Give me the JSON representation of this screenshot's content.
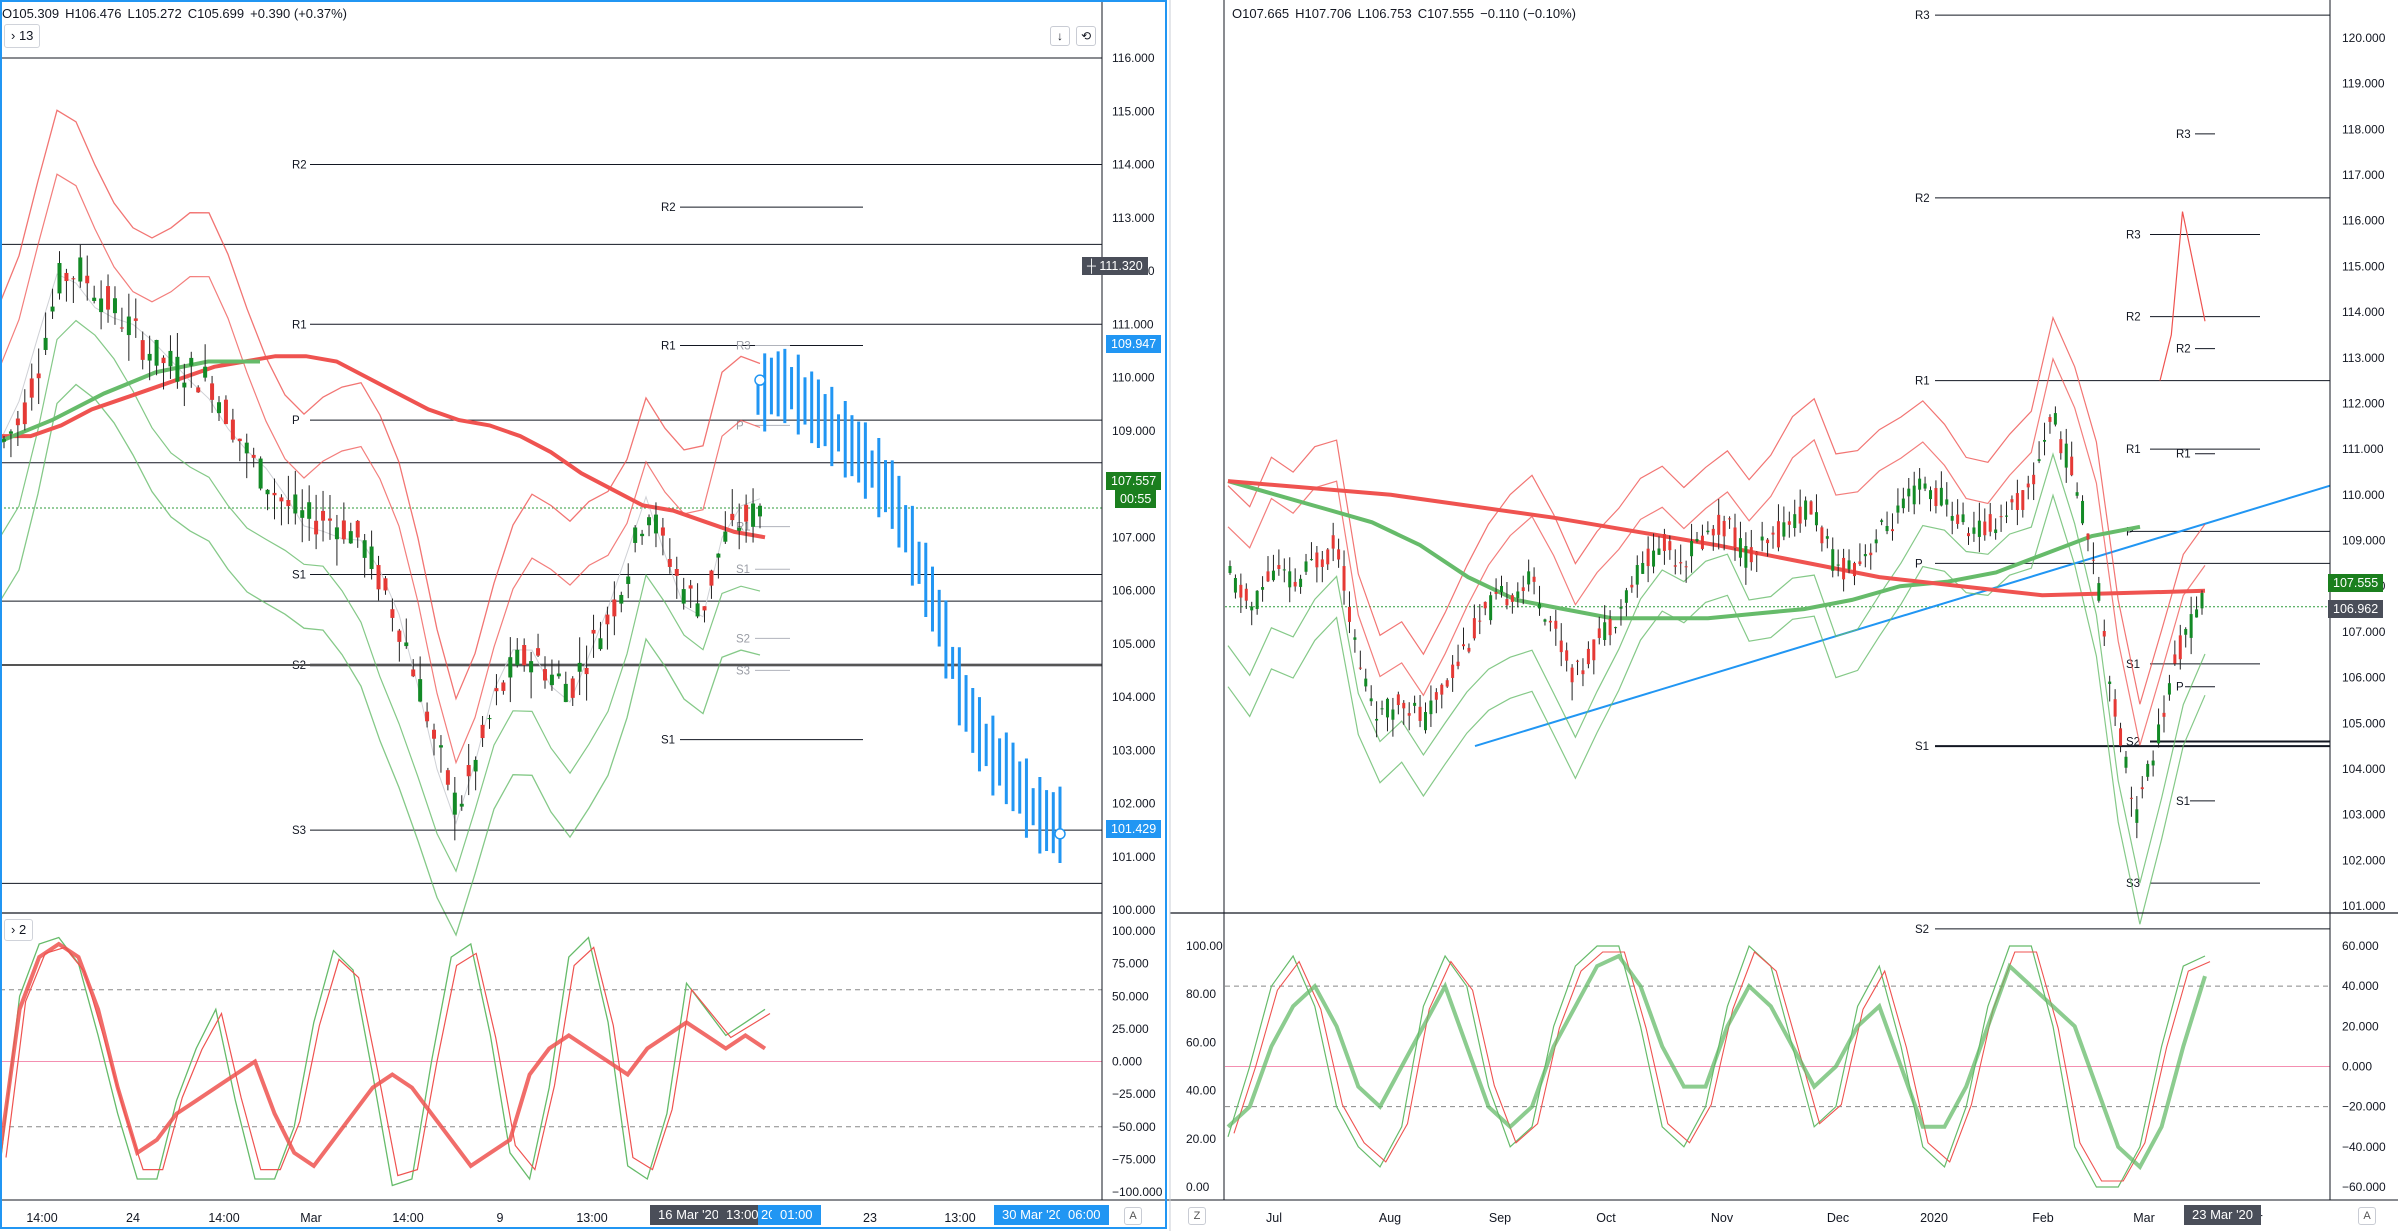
{
  "colors": {
    "accent": "#2196f3",
    "up": "#26a69a",
    "candle_up": "#138a26",
    "candle_down": "#e53935",
    "ma_red": "#ef5350",
    "ma_green": "#66bb6a",
    "grid": "#131722",
    "stoch_pink": "#f48fb1"
  },
  "left": {
    "ohlc": {
      "open": "O105.309",
      "high": "H106.476",
      "low": "L105.272",
      "close": "C105.699",
      "change": "+0.390 (+0.37%)"
    },
    "collapse_main": "13",
    "collapse_sub": "2",
    "price_axis": [
      "116.000",
      "115.000",
      "114.000",
      "113.000",
      "112.000",
      "111.000",
      "110.000",
      "109.000",
      "108.000",
      "107.000",
      "106.000",
      "105.000",
      "104.000",
      "103.000",
      "102.000",
      "101.000",
      "100.000"
    ],
    "price_tags": {
      "crosshair": "111.320",
      "blue_high": "109.947",
      "last": "107.557",
      "countdown": "00:55",
      "blue_low": "101.429"
    },
    "osc_axis": [
      "100.000",
      "75.000",
      "50.000",
      "25.000",
      "0.000",
      "−25.000",
      "−50.000",
      "−75.000",
      "−100.000"
    ],
    "time_axis": [
      "14:00",
      "24",
      "14:00",
      "Mar",
      "14:00",
      "9",
      "13:00",
      "23",
      "13:00"
    ],
    "time_badges": {
      "date1": "16 Mar '20",
      "time1": "13:00",
      "time2": "20",
      "time3": "01:00",
      "date2": "30 Mar '20",
      "time4": "06:00"
    },
    "scale_mode": "A",
    "pivot_labels": {
      "R2a": "R2",
      "R1a": "R1",
      "Pa": "P",
      "S1a": "S1",
      "S2a": "S2",
      "S3a": "S3",
      "R2b": "R2",
      "R1b": "R1",
      "S1b": "S1",
      "R3c": "R3",
      "P2c": "P",
      "R1c": "R1",
      "S1c": "S1",
      "S2c": "S2",
      "S3c": "S3"
    }
  },
  "right": {
    "ohlc": {
      "open": "O107.665",
      "high": "H107.706",
      "low": "L106.753",
      "close": "C107.555",
      "change": "−0.110 (−0.10%)"
    },
    "price_axis": [
      "120.000",
      "119.000",
      "118.000",
      "117.000",
      "116.000",
      "115.000",
      "114.000",
      "113.000",
      "112.000",
      "111.000",
      "110.000",
      "109.000",
      "108.000",
      "107.000",
      "106.000",
      "105.000",
      "104.000",
      "103.000",
      "102.000",
      "101.000"
    ],
    "price_tags": {
      "last": "107.555",
      "secondary": "106.962"
    },
    "osc_left_axis": [
      "100.00",
      "80.00",
      "60.00",
      "40.00",
      "20.00",
      "0.00"
    ],
    "osc_right_axis": [
      "60.000",
      "40.000",
      "20.000",
      "0.000",
      "−20.000",
      "−40.000",
      "−60.000"
    ],
    "time_axis": [
      "Jul",
      "Aug",
      "Sep",
      "Oct",
      "Nov",
      "Dec",
      "2020",
      "Feb",
      "Mar",
      "pr"
    ],
    "time_badge": "23 Mar '20",
    "scale_mode_left": "Z",
    "scale_mode_right": "A",
    "pivot_labels": {
      "R3a": "R3",
      "R2a": "R2",
      "R1a": "R1",
      "Pa": "P",
      "S1a": "S1",
      "S2a": "S2",
      "R3b": "R3",
      "R3c": "R3",
      "R2c": "R2",
      "R2d": "R2",
      "R1c": "R1",
      "R1d": "R1",
      "Pc": "P",
      "S1c": "S1",
      "S2c": "S2",
      "Pd": "P",
      "S1d": "S1",
      "S3d": "S3"
    }
  },
  "chart_data": [
    {
      "type": "line",
      "title": "",
      "ylim": [
        100,
        116
      ],
      "y_ticks": [
        116,
        115,
        114,
        113,
        112,
        111,
        110,
        109,
        108,
        107,
        106,
        105,
        104,
        103,
        102,
        101,
        100
      ],
      "x_ticks": [
        "14:00",
        "24",
        "14:00",
        "Mar",
        "14:00",
        "9",
        "13:00",
        "23",
        "13:00"
      ],
      "series": [
        {
          "values": [
            108.8,
            109.3,
            110.5,
            111.9,
            112.0,
            111.6,
            111.2,
            110.8,
            110.4,
            110.2,
            110.1,
            109.9,
            109.2,
            108.5,
            108.0,
            107.6,
            107.3,
            107.4,
            107.2,
            106.9,
            106.1,
            105.3,
            104.2,
            102.9,
            101.9,
            102.8,
            103.9,
            104.6,
            104.8,
            104.4,
            104.2,
            104.9,
            105.5,
            106.4,
            107.6,
            106.8,
            106.0,
            105.7,
            106.9,
            107.3,
            107.5
          ]
        },
        {
          "values": [
            108.9,
            108.9,
            109.1,
            109.4,
            109.6,
            109.8,
            110.0,
            110.2,
            110.3,
            110.4,
            110.4,
            110.3,
            110.0,
            109.7,
            109.4,
            109.2,
            109.1,
            108.9,
            108.6,
            108.2,
            107.9,
            107.6,
            107.5,
            107.3,
            107.1,
            107.0
          ]
        },
        {
          "values": [
            109.6,
            109.9,
            109.8,
            109.5,
            109.2,
            108.9,
            108.6,
            108.2,
            107.8,
            107.0,
            106.2,
            105.3,
            104.2,
            103.4,
            102.9,
            102.6,
            102.1,
            101.7,
            101.6
          ]
        }
      ],
      "pivots": [
        {
          "label": "R2",
          "value": 114.0
        },
        {
          "label": "R1",
          "value": 111.0
        },
        {
          "label": "P",
          "value": 109.2
        },
        {
          "label": "S1",
          "value": 106.3
        },
        {
          "label": "S2",
          "value": 104.6
        },
        {
          "label": "S3",
          "value": 101.5
        },
        {
          "label": "R2",
          "value": 113.2
        },
        {
          "label": "R1",
          "value": 110.6
        },
        {
          "label": "S1",
          "value": 103.2
        },
        {
          "label": "R3",
          "value": 110.6
        },
        {
          "label": "P",
          "value": 109.1
        },
        {
          "label": "R1",
          "value": 107.2
        },
        {
          "label": "S1",
          "value": 106.4
        },
        {
          "label": "S2",
          "value": 105.1
        },
        {
          "label": "S3",
          "value": 104.5
        }
      ],
      "extra_lines": [
        112.5,
        108.4,
        105.8,
        100.5
      ]
    },
    {
      "type": "line",
      "title": "",
      "ylim": [
        -100,
        100
      ],
      "y_ticks": [
        100,
        75,
        50,
        25,
        0,
        -25,
        -50,
        -75,
        -100
      ],
      "levels": [
        55,
        0,
        -50
      ],
      "series": [
        {
          "values": [
            -70,
            40,
            80,
            90,
            80,
            40,
            -20,
            -70,
            -60,
            -40,
            -30,
            -20,
            -10,
            0,
            -40,
            -70,
            -80,
            -60,
            -40,
            -20,
            -10,
            -20,
            -40,
            -60,
            -80,
            -70,
            -60,
            -10,
            10,
            20,
            10,
            0,
            -10,
            10,
            20,
            30,
            20,
            10,
            20,
            10
          ]
        },
        {
          "values": [
            -80,
            50,
            90,
            95,
            75,
            20,
            -40,
            -90,
            -90,
            -30,
            10,
            40,
            -30,
            -90,
            -90,
            -50,
            30,
            85,
            70,
            -10,
            -95,
            -90,
            0,
            80,
            90,
            20,
            -70,
            -90,
            -20,
            80,
            95,
            30,
            -80,
            -90,
            -40,
            60,
            40,
            20,
            30,
            40
          ]
        }
      ]
    },
    {
      "type": "line",
      "title": "",
      "ylim": [
        101,
        120
      ],
      "y_ticks": [
        120,
        119,
        118,
        117,
        116,
        115,
        114,
        113,
        112,
        111,
        110,
        109,
        108,
        107,
        106,
        105,
        104,
        103,
        102,
        101
      ],
      "x_ticks": [
        "Jul",
        "Aug",
        "Sep",
        "Oct",
        "Nov",
        "Dec",
        "2020",
        "Feb",
        "Mar",
        "pr"
      ],
      "series": [
        {
          "values": [
            108.2,
            107.5,
            108.4,
            108.0,
            108.6,
            108.9,
            106.2,
            105.1,
            105.6,
            105.0,
            105.9,
            106.8,
            107.5,
            107.9,
            108.1,
            107.1,
            106.0,
            106.8,
            107.5,
            108.4,
            108.9,
            108.6,
            109.1,
            109.4,
            108.6,
            108.9,
            109.5,
            109.7,
            108.4,
            108.5,
            109.1,
            109.6,
            110.2,
            109.9,
            109.3,
            109.2,
            109.7,
            110.0,
            111.8,
            110.5,
            108.7,
            105.2,
            103.0,
            104.8,
            106.7,
            107.6
          ]
        },
        {
          "values": [
            110.3,
            110.0,
            109.7,
            109.4,
            108.9,
            108.2,
            107.7,
            107.5,
            107.3,
            107.3,
            107.3,
            107.4,
            107.5,
            107.7,
            108.0,
            108.1,
            108.3,
            108.7,
            109.1,
            109.3
          ]
        },
        {
          "values": [
            110.3,
            110.0,
            109.5,
            108.9,
            108.2,
            107.8,
            107.9
          ]
        },
        {
          "values": [
            104.5,
            110.3
          ]
        }
      ],
      "pivots": [
        {
          "label": "R3",
          "value": 120.5
        },
        {
          "label": "R2",
          "value": 116.5
        },
        {
          "label": "R1",
          "value": 112.5
        },
        {
          "label": "P",
          "value": 108.5
        },
        {
          "label": "S1",
          "value": 104.5
        },
        {
          "label": "S2",
          "value": 100.5
        },
        {
          "label": "R3",
          "value": 117.9
        },
        {
          "label": "R3",
          "value": 115.7
        },
        {
          "label": "R2",
          "value": 113.9
        },
        {
          "label": "R2",
          "value": 113.2
        },
        {
          "label": "R1",
          "value": 111.0
        },
        {
          "label": "R1",
          "value": 110.9
        },
        {
          "label": "P",
          "value": 109.2
        },
        {
          "label": "S1",
          "value": 106.3
        },
        {
          "label": "S2",
          "value": 104.6
        },
        {
          "label": "P",
          "value": 105.8
        },
        {
          "label": "S1",
          "value": 103.3
        },
        {
          "label": "S3",
          "value": 101.5
        }
      ]
    },
    {
      "type": "line",
      "title": "",
      "ylim": [
        -60,
        60
      ],
      "y_ticks": [
        60,
        40,
        20,
        0,
        -20,
        -40,
        -60
      ],
      "y_ticks_left": [
        100,
        80,
        60,
        40,
        20,
        0
      ],
      "levels": [
        40,
        0,
        -20
      ],
      "series": [
        {
          "values": [
            -30,
            -20,
            10,
            30,
            40,
            20,
            -10,
            -20,
            0,
            20,
            40,
            10,
            -20,
            -30,
            -20,
            10,
            30,
            50,
            55,
            40,
            10,
            -10,
            -10,
            20,
            40,
            30,
            10,
            -10,
            0,
            20,
            30,
            0,
            -30,
            -30,
            -10,
            20,
            50,
            40,
            30,
            20,
            -10,
            -40,
            -50,
            -30,
            10,
            45
          ]
        },
        {
          "values": [
            -35,
            0,
            40,
            55,
            30,
            -20,
            -40,
            -50,
            -30,
            30,
            55,
            40,
            -10,
            -40,
            -30,
            20,
            50,
            60,
            60,
            20,
            -30,
            -40,
            -20,
            30,
            60,
            50,
            10,
            -30,
            -20,
            30,
            50,
            10,
            -40,
            -50,
            -20,
            30,
            60,
            60,
            20,
            -40,
            -60,
            -60,
            -40,
            10,
            50,
            55
          ]
        }
      ]
    }
  ]
}
